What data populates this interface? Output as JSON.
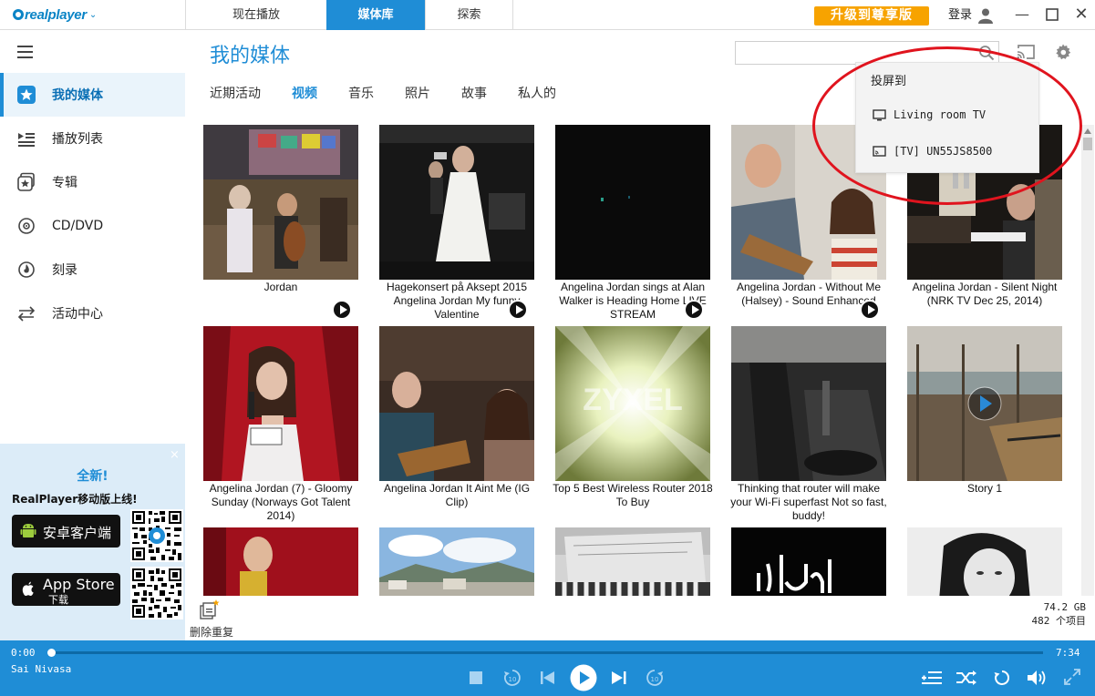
{
  "app": {
    "logo_text": "realplayer"
  },
  "tabs": [
    {
      "label": "现在播放"
    },
    {
      "label": "媒体库"
    },
    {
      "label": "探索"
    }
  ],
  "topbar": {
    "upgrade_label": "升级到尊享版",
    "login_label": "登录"
  },
  "sidebar": {
    "items": [
      {
        "label": "我的媒体",
        "icon": "star-icon",
        "active": true
      },
      {
        "label": "播放列表",
        "icon": "playlist-icon"
      },
      {
        "label": "专辑",
        "icon": "album-icon"
      },
      {
        "label": "CD/DVD",
        "icon": "disc-icon"
      },
      {
        "label": "刻录",
        "icon": "burn-icon"
      },
      {
        "label": "活动中心",
        "icon": "activity-icon"
      }
    ],
    "promo": {
      "new_label": "全新!",
      "subtitle": "RealPlayer移动版上线!",
      "android_label": "安卓客户端",
      "appstore_label": "App Store",
      "appstore_sub": "下载",
      "close": "×"
    }
  },
  "main": {
    "title": "我的媒体",
    "subtabs": [
      {
        "label": "近期活动"
      },
      {
        "label": "视频",
        "active": true
      },
      {
        "label": "音乐"
      },
      {
        "label": "照片"
      },
      {
        "label": "故事"
      },
      {
        "label": "私人的"
      }
    ],
    "search": {
      "placeholder": ""
    }
  },
  "cast_menu": {
    "title": "投屏到",
    "devices": [
      {
        "label": "Living room TV",
        "icon": "monitor-icon"
      },
      {
        "label": "[TV] UN55JS8500",
        "icon": "cast-tv-icon"
      }
    ]
  },
  "videos": [
    {
      "title": "Jordan"
    },
    {
      "title": "Hagekonsert på Aksept 2015 Angelina Jordan  My funny Valentine"
    },
    {
      "title": "Angelina Jordan sings at  Alan Walker is Heading Home LIVE STREAM"
    },
    {
      "title": "Angelina Jordan - Without Me (Halsey) - Sound Enhanced"
    },
    {
      "title": "Angelina Jordan - Silent Night (NRK TV Dec 25, 2014)"
    },
    {
      "title": "Angelina Jordan (7) - Gloomy Sunday (Norways Got Talent 2014)"
    },
    {
      "title": "Angelina Jordan  It Aint Me   (IG Clip)"
    },
    {
      "title": "Top 5 Best Wireless Router 2018 To Buy"
    },
    {
      "title": "Thinking that router will make your Wi-Fi superfast  Not so fast, buddy!"
    },
    {
      "title": "Story 1"
    },
    {
      "title": ""
    },
    {
      "title": ""
    },
    {
      "title": ""
    },
    {
      "title": ""
    },
    {
      "title": ""
    }
  ],
  "footer": {
    "dedupe_label": "删除重复",
    "size_text": "74.2 GB",
    "count_text": "482 个项目"
  },
  "player": {
    "current_time": "0:00",
    "total_time": "7:34",
    "track_name": "Sai Nivasa",
    "progress": 0
  },
  "colors": {
    "accent": "#1f8dd6",
    "upgrade": "#f7a300",
    "highlight_ellipse": "#e0141e"
  }
}
